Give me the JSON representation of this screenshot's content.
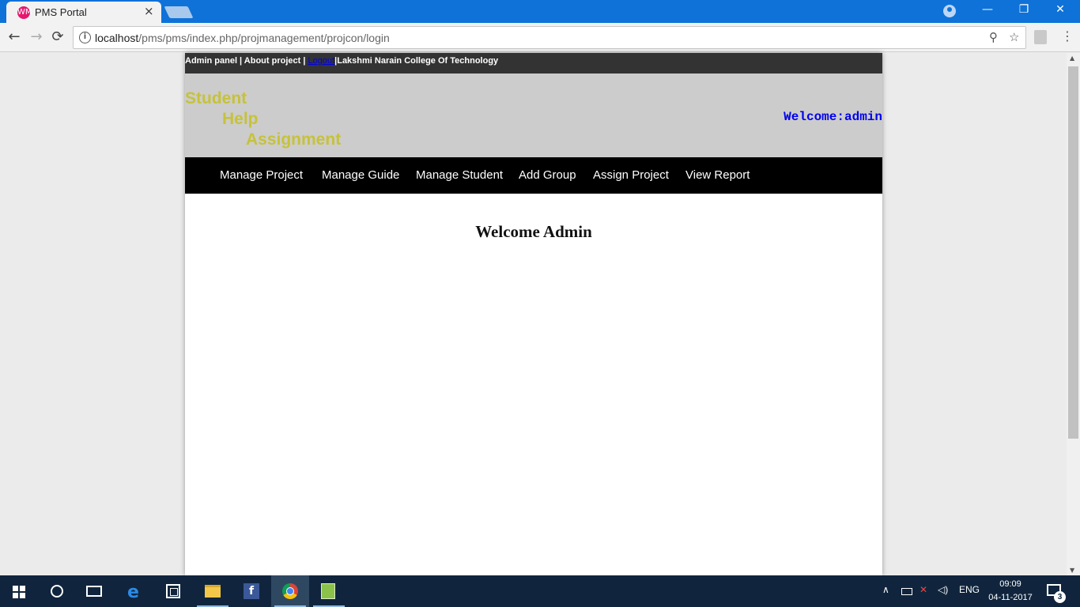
{
  "browser": {
    "tab_title": "PMS Portal",
    "tab_favicon": "WM",
    "tab_close": "×",
    "url_host": "localhost",
    "url_path": "/pms/pms/index.php/projmanagement/projcon/login",
    "win_minimize": "—",
    "win_restore": "❐",
    "win_close": "✕",
    "back": "←",
    "forward": "→",
    "reload": "⟳",
    "info": "i",
    "zoom": "⚲",
    "star": "☆",
    "menu": "⋮"
  },
  "page": {
    "topbar": {
      "admin_panel": "Admin panel | About project | ",
      "logout": "Logout",
      "college": "|Lakshmi Narain College Of Technology"
    },
    "logo": [
      "Student",
      "Help",
      "Assignment"
    ],
    "welcome_user": "Welcome:admin",
    "menu": [
      "Manage Project",
      "Manage Guide",
      "Manage Student",
      "Add Group",
      "Assign Project",
      "View Report"
    ],
    "main_title": "Welcome Admin"
  },
  "taskbar": {
    "lang": "ENG",
    "time": "09:09",
    "date": "04-11-2017",
    "notifications": "3",
    "tray_up": "∧",
    "volume": "🔊"
  },
  "colors": {
    "logo": "#c6c23a",
    "welcome_user": "#0000ee",
    "topbar_bg": "#333333",
    "header_bg": "#cccccc",
    "menubar_bg": "#000000"
  }
}
